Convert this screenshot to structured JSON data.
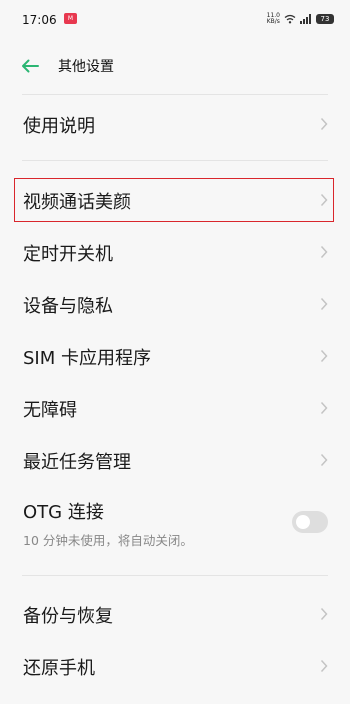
{
  "status_bar": {
    "time": "17:06",
    "notification_badge": "M",
    "network_speed_top": "11.0",
    "network_speed_bottom": "KB/s",
    "battery": "73"
  },
  "header": {
    "title": "其他设置",
    "back_icon": "arrow-left-icon",
    "accent_color": "#2bb673"
  },
  "menu": {
    "items": [
      {
        "label": "使用说明"
      },
      {
        "label": "视频通话美颜",
        "highlighted": true
      },
      {
        "label": "定时开关机"
      },
      {
        "label": "设备与隐私"
      },
      {
        "label": "SIM 卡应用程序"
      },
      {
        "label": "无障碍"
      },
      {
        "label": "最近任务管理"
      },
      {
        "label": "OTG 连接",
        "subtitle": "10 分钟未使用，将自动关闭。",
        "toggle_on": false
      },
      {
        "label": "备份与恢复"
      },
      {
        "label": "还原手机"
      }
    ]
  },
  "colors": {
    "background": "#f7f7f7",
    "highlight_border": "#d9262c"
  }
}
